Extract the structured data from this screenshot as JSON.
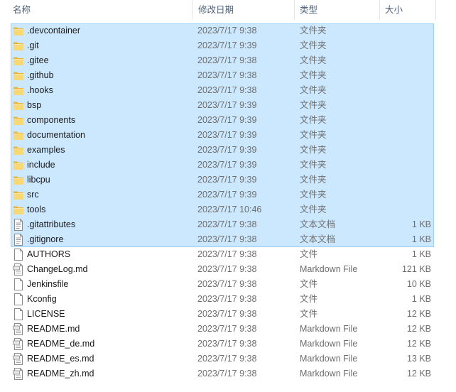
{
  "columns": {
    "name": "名称",
    "date": "修改日期",
    "type": "类型",
    "size": "大小"
  },
  "colors": {
    "selection_fill": "#cce8ff",
    "selection_border": "#99d1ff",
    "folder": "#f5c84b"
  },
  "files": [
    {
      "name": ".devcontainer",
      "date": "2023/7/17 9:38",
      "type": "文件夹",
      "size": "",
      "icon": "folder-icon"
    },
    {
      "name": ".git",
      "date": "2023/7/17 9:39",
      "type": "文件夹",
      "size": "",
      "icon": "folder-icon"
    },
    {
      "name": ".gitee",
      "date": "2023/7/17 9:38",
      "type": "文件夹",
      "size": "",
      "icon": "folder-icon"
    },
    {
      "name": ".github",
      "date": "2023/7/17 9:38",
      "type": "文件夹",
      "size": "",
      "icon": "folder-icon"
    },
    {
      "name": ".hooks",
      "date": "2023/7/17 9:38",
      "type": "文件夹",
      "size": "",
      "icon": "folder-icon"
    },
    {
      "name": "bsp",
      "date": "2023/7/17 9:39",
      "type": "文件夹",
      "size": "",
      "icon": "folder-icon"
    },
    {
      "name": "components",
      "date": "2023/7/17 9:39",
      "type": "文件夹",
      "size": "",
      "icon": "folder-icon"
    },
    {
      "name": "documentation",
      "date": "2023/7/17 9:39",
      "type": "文件夹",
      "size": "",
      "icon": "folder-icon"
    },
    {
      "name": "examples",
      "date": "2023/7/17 9:39",
      "type": "文件夹",
      "size": "",
      "icon": "folder-icon"
    },
    {
      "name": "include",
      "date": "2023/7/17 9:39",
      "type": "文件夹",
      "size": "",
      "icon": "folder-icon"
    },
    {
      "name": "libcpu",
      "date": "2023/7/17 9:39",
      "type": "文件夹",
      "size": "",
      "icon": "folder-icon"
    },
    {
      "name": "src",
      "date": "2023/7/17 9:39",
      "type": "文件夹",
      "size": "",
      "icon": "folder-icon"
    },
    {
      "name": "tools",
      "date": "2023/7/17 10:46",
      "type": "文件夹",
      "size": "",
      "icon": "folder-icon"
    },
    {
      "name": ".gitattributes",
      "date": "2023/7/17 9:38",
      "type": "文本文档",
      "size": "1 KB",
      "icon": "text-document-icon"
    },
    {
      "name": ".gitignore",
      "date": "2023/7/17 9:38",
      "type": "文本文档",
      "size": "1 KB",
      "icon": "text-document-icon"
    },
    {
      "name": "AUTHORS",
      "date": "2023/7/17 9:38",
      "type": "文件",
      "size": "1 KB",
      "icon": "file-icon"
    },
    {
      "name": "ChangeLog.md",
      "date": "2023/7/17 9:38",
      "type": "Markdown File",
      "size": "121 KB",
      "icon": "markdown-file-icon"
    },
    {
      "name": "Jenkinsfile",
      "date": "2023/7/17 9:38",
      "type": "文件",
      "size": "10 KB",
      "icon": "file-icon"
    },
    {
      "name": "Kconfig",
      "date": "2023/7/17 9:38",
      "type": "文件",
      "size": "1 KB",
      "icon": "file-icon"
    },
    {
      "name": "LICENSE",
      "date": "2023/7/17 9:38",
      "type": "文件",
      "size": "12 KB",
      "icon": "file-icon"
    },
    {
      "name": "README.md",
      "date": "2023/7/17 9:38",
      "type": "Markdown File",
      "size": "12 KB",
      "icon": "markdown-file-icon"
    },
    {
      "name": "README_de.md",
      "date": "2023/7/17 9:38",
      "type": "Markdown File",
      "size": "12 KB",
      "icon": "markdown-file-icon"
    },
    {
      "name": "README_es.md",
      "date": "2023/7/17 9:38",
      "type": "Markdown File",
      "size": "13 KB",
      "icon": "markdown-file-icon"
    },
    {
      "name": "README_zh.md",
      "date": "2023/7/17 9:38",
      "type": "Markdown File",
      "size": "12 KB",
      "icon": "markdown-file-icon"
    }
  ]
}
